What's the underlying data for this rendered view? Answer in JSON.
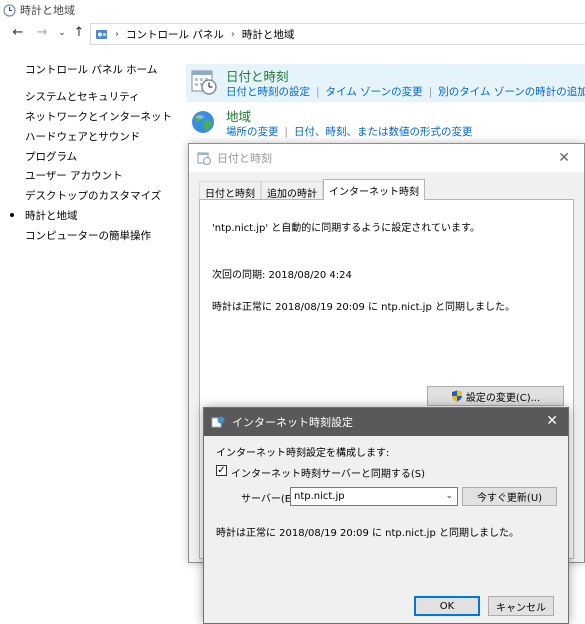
{
  "window": {
    "title": "時計と地域"
  },
  "address": {
    "crumbs": [
      "コントロール パネル",
      "時計と地域"
    ]
  },
  "sidebar": {
    "home": "コントロール パネル ホーム",
    "items": [
      {
        "label": "システムとセキュリティ"
      },
      {
        "label": "ネットワークとインターネット"
      },
      {
        "label": "ハードウェアとサウンド"
      },
      {
        "label": "プログラム"
      },
      {
        "label": "ユーザー アカウント"
      },
      {
        "label": "デスクトップのカスタマイズ"
      },
      {
        "label": "時計と地域"
      },
      {
        "label": "コンピューターの簡単操作"
      }
    ]
  },
  "categories": [
    {
      "title": "日付と時刻",
      "links": [
        "日付と時刻の設定",
        "タイム ゾーンの変更",
        "別のタイム ゾーンの時計の追加"
      ]
    },
    {
      "title": "地域",
      "links": [
        "場所の変更",
        "日付、時刻、または数値の形式の変更"
      ]
    }
  ],
  "datetime_dialog": {
    "title": "日付と時刻",
    "tabs": [
      "日付と時刻",
      "追加の時計",
      "インターネット時刻"
    ],
    "sync_config": "'ntp.nict.jp' と自動的に同期するように設定されています。",
    "next_sync": "次回の同期: 2018/08/20 4:24",
    "last_sync": "時計は正常に 2018/08/19 20:09 に ntp.nict.jp と同期しました。",
    "change_button": "設定の変更(C)..."
  },
  "internet_time_dialog": {
    "title": "インターネット時刻設定",
    "configure_label": "インターネット時刻設定を構成します:",
    "sync_checkbox_label": "インターネット時刻サーバーと同期する(S)",
    "sync_checked": true,
    "server_label": "サーバー(E):",
    "server_value": "ntp.nict.jp",
    "update_button": "今すぐ更新(U)",
    "status": "時計は正常に 2018/08/19 20:09 に ntp.nict.jp と同期しました。",
    "ok_button": "OK",
    "cancel_button": "キャンセル"
  }
}
